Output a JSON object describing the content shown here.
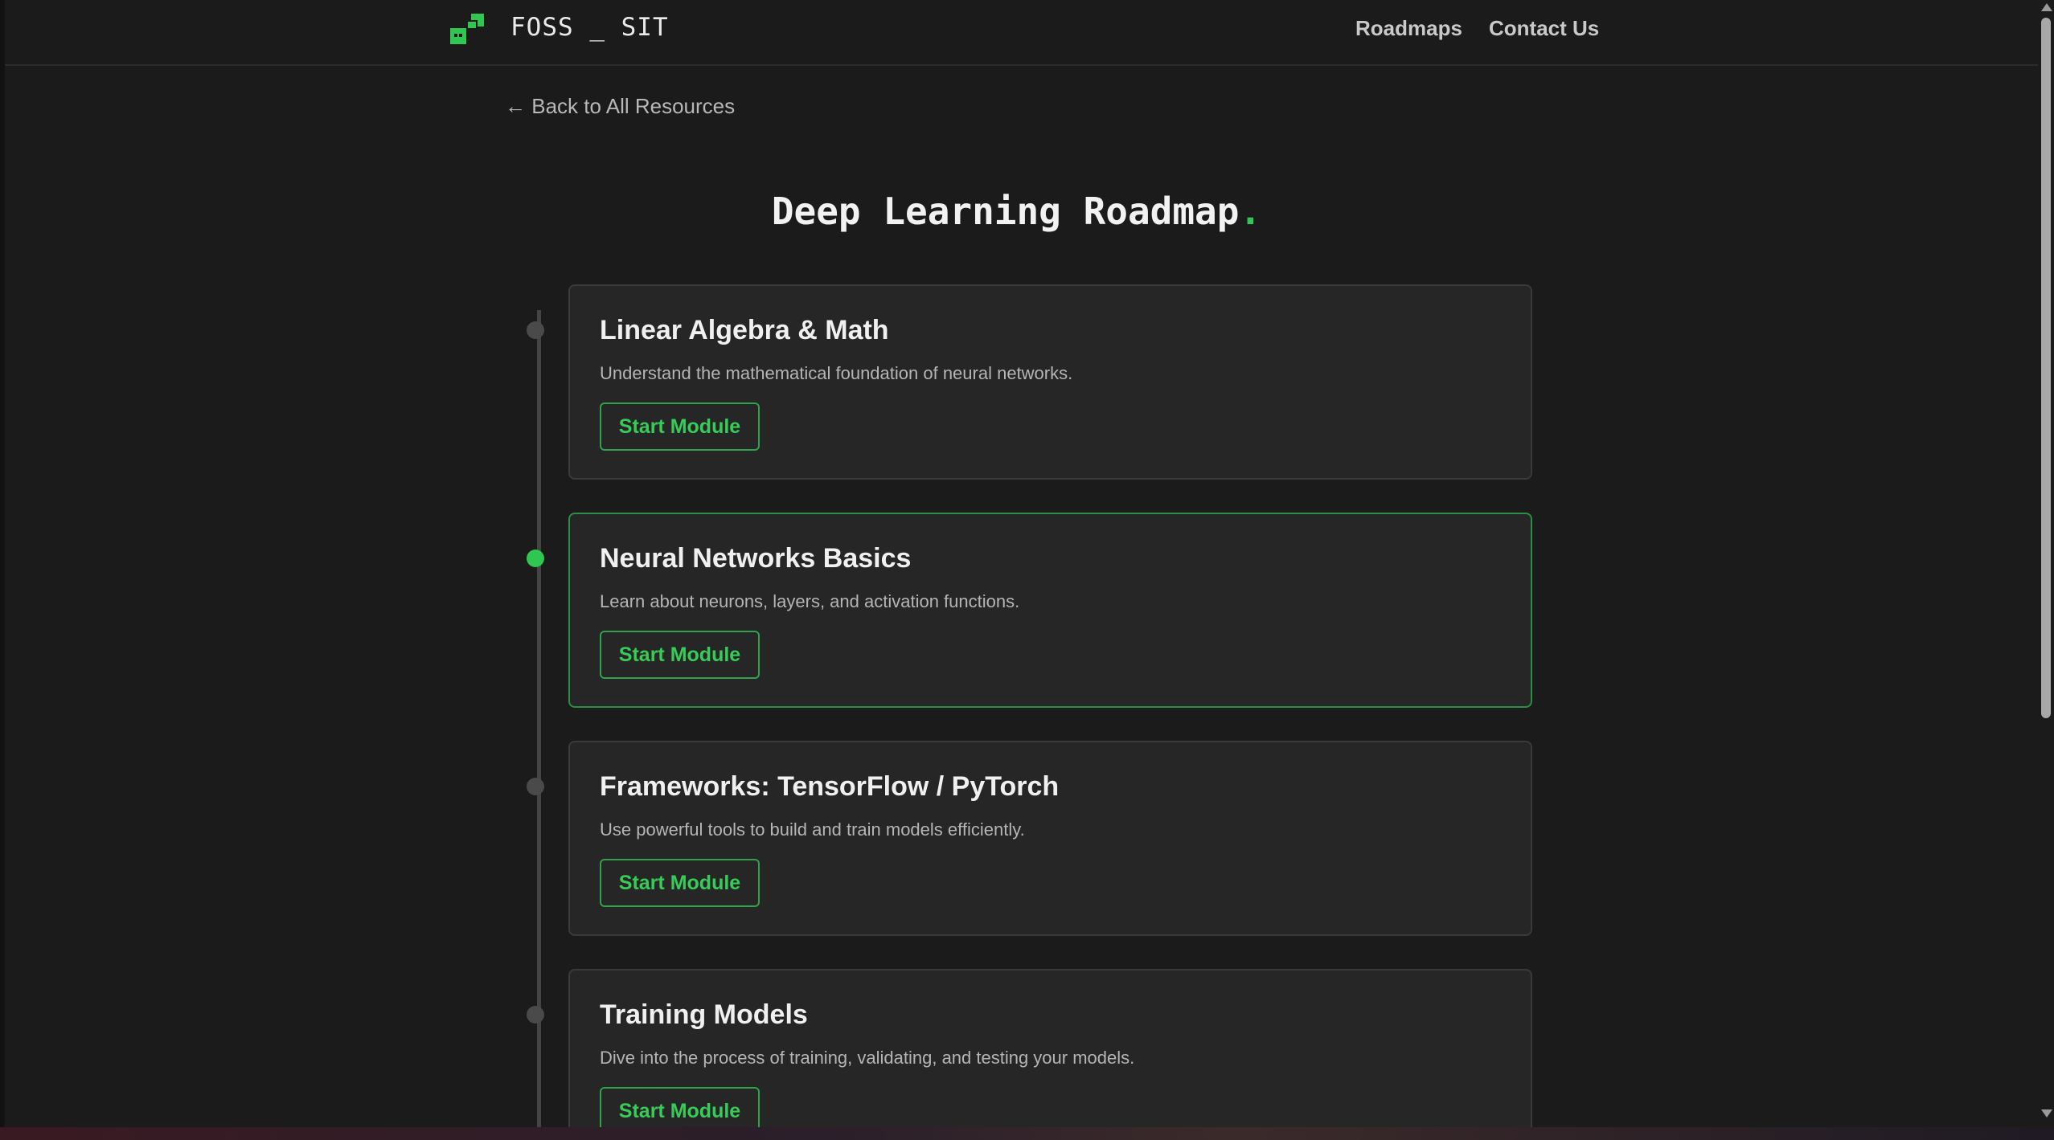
{
  "header": {
    "brand": "FOSS _ SIT",
    "nav": {
      "roadmaps": "Roadmaps",
      "contact": "Contact Us"
    }
  },
  "back_link": "← Back to All Resources",
  "page": {
    "title": "Deep Learning Roadmap",
    "title_dot": "."
  },
  "modules": [
    {
      "title": "Linear Algebra & Math",
      "description": "Understand the mathematical foundation of neural networks.",
      "button": "Start Module",
      "active": false
    },
    {
      "title": "Neural Networks Basics",
      "description": "Learn about neurons, layers, and activation functions.",
      "button": "Start Module",
      "active": true
    },
    {
      "title": "Frameworks: TensorFlow / PyTorch",
      "description": "Use powerful tools to build and train models efficiently.",
      "button": "Start Module",
      "active": false
    },
    {
      "title": "Training Models",
      "description": "Dive into the process of training, validating, and testing your models.",
      "button": "Start Module",
      "active": false
    }
  ],
  "colors": {
    "accent": "#2fc651",
    "background": "#1b1b1b",
    "card": "#262626"
  },
  "icons": {
    "logo": "foss-logo-icon"
  }
}
